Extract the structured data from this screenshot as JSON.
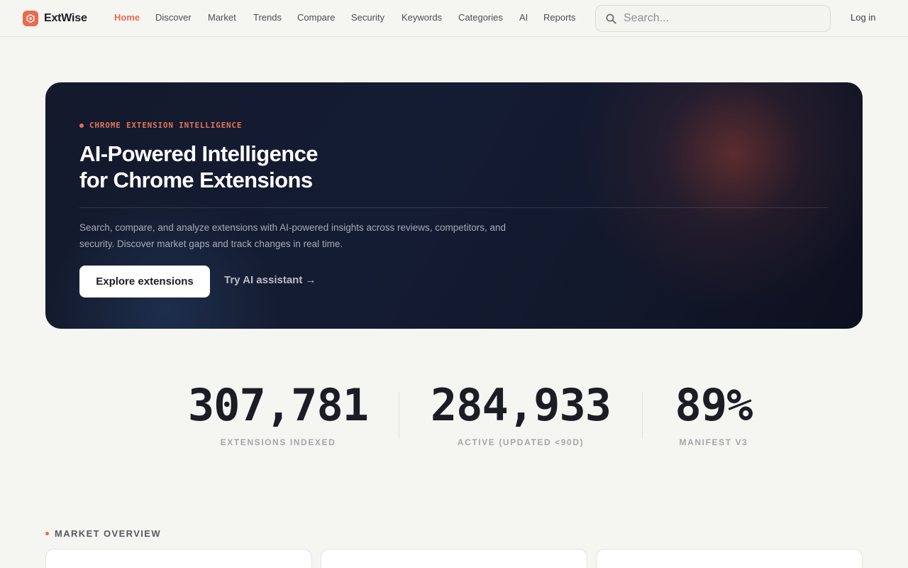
{
  "brand": {
    "name": "ExtWise",
    "accent": "#ec6a4c"
  },
  "nav": {
    "items": [
      {
        "label": "Home",
        "active": true
      },
      {
        "label": "Discover",
        "active": false
      },
      {
        "label": "Market",
        "active": false
      },
      {
        "label": "Trends",
        "active": false
      },
      {
        "label": "Compare",
        "active": false
      },
      {
        "label": "Security",
        "active": false
      },
      {
        "label": "Keywords",
        "active": false
      },
      {
        "label": "Categories",
        "active": false
      },
      {
        "label": "AI",
        "active": false
      },
      {
        "label": "Reports",
        "active": false
      }
    ]
  },
  "search": {
    "placeholder": "Search...",
    "icon": "search-icon"
  },
  "auth": {
    "login_label": "Log in"
  },
  "hero": {
    "eyebrow": "CHROME EXTENSION INTELLIGENCE",
    "title_line1": "AI-Powered Intelligence",
    "title_line2": "for Chrome Extensions",
    "description": "Search, compare, and analyze extensions with AI-powered insights across reviews, competitors, and security. Discover market gaps and track changes in real time.",
    "primary_cta": "Explore extensions",
    "secondary_cta": "Try AI assistant →"
  },
  "stats": [
    {
      "value": "307,781",
      "label": "EXTENSIONS INDEXED"
    },
    {
      "value": "284,933",
      "label": "ACTIVE (UPDATED <90D)"
    },
    {
      "value": "89%",
      "label": "MANIFEST V3"
    }
  ],
  "market": {
    "title": "MARKET OVERVIEW"
  }
}
